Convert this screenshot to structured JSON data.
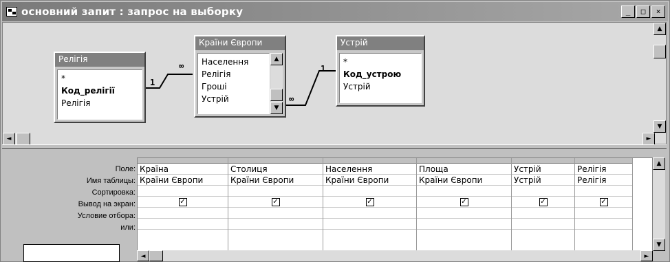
{
  "window": {
    "title": "основний запит : запрос на выборку",
    "controls": {
      "minimize": "_",
      "maximize": "□",
      "close": "×"
    }
  },
  "tables": [
    {
      "name": "Релігія",
      "fields": [
        "*",
        "Код_релігії",
        "Релігія"
      ],
      "key_field": "Код_релігії"
    },
    {
      "name": "Країни Європи",
      "fields": [
        "Населення",
        "Релігія",
        "Гроші",
        "Устрій"
      ]
    },
    {
      "name": "Устрій",
      "fields": [
        "*",
        "Код_устрою",
        "Устрій"
      ],
      "key_field": "Код_устрою"
    }
  ],
  "relations": [
    {
      "one": "1",
      "many": "∞"
    },
    {
      "one": "1",
      "many": "∞"
    }
  ],
  "grid": {
    "row_labels": [
      "Поле:",
      "Имя таблицы:",
      "Сортировка:",
      "Вывод на экран:",
      "Условие отбора:",
      "или:"
    ],
    "columns": [
      {
        "field": "Країна",
        "table": "Країни Європи",
        "show": true
      },
      {
        "field": "Столиця",
        "table": "Країни Європи",
        "show": true
      },
      {
        "field": "Населення",
        "table": "Країни Європи",
        "show": true
      },
      {
        "field": "Площа",
        "table": "Країни Європи",
        "show": true
      },
      {
        "field": "Устрій",
        "table": "Устрій",
        "show": true
      },
      {
        "field": "Релігія",
        "table": "Релігія",
        "show": true
      }
    ],
    "check_mark": "✓"
  },
  "scroll_arrows": {
    "up": "▲",
    "down": "▼",
    "left": "◄",
    "right": "►"
  }
}
